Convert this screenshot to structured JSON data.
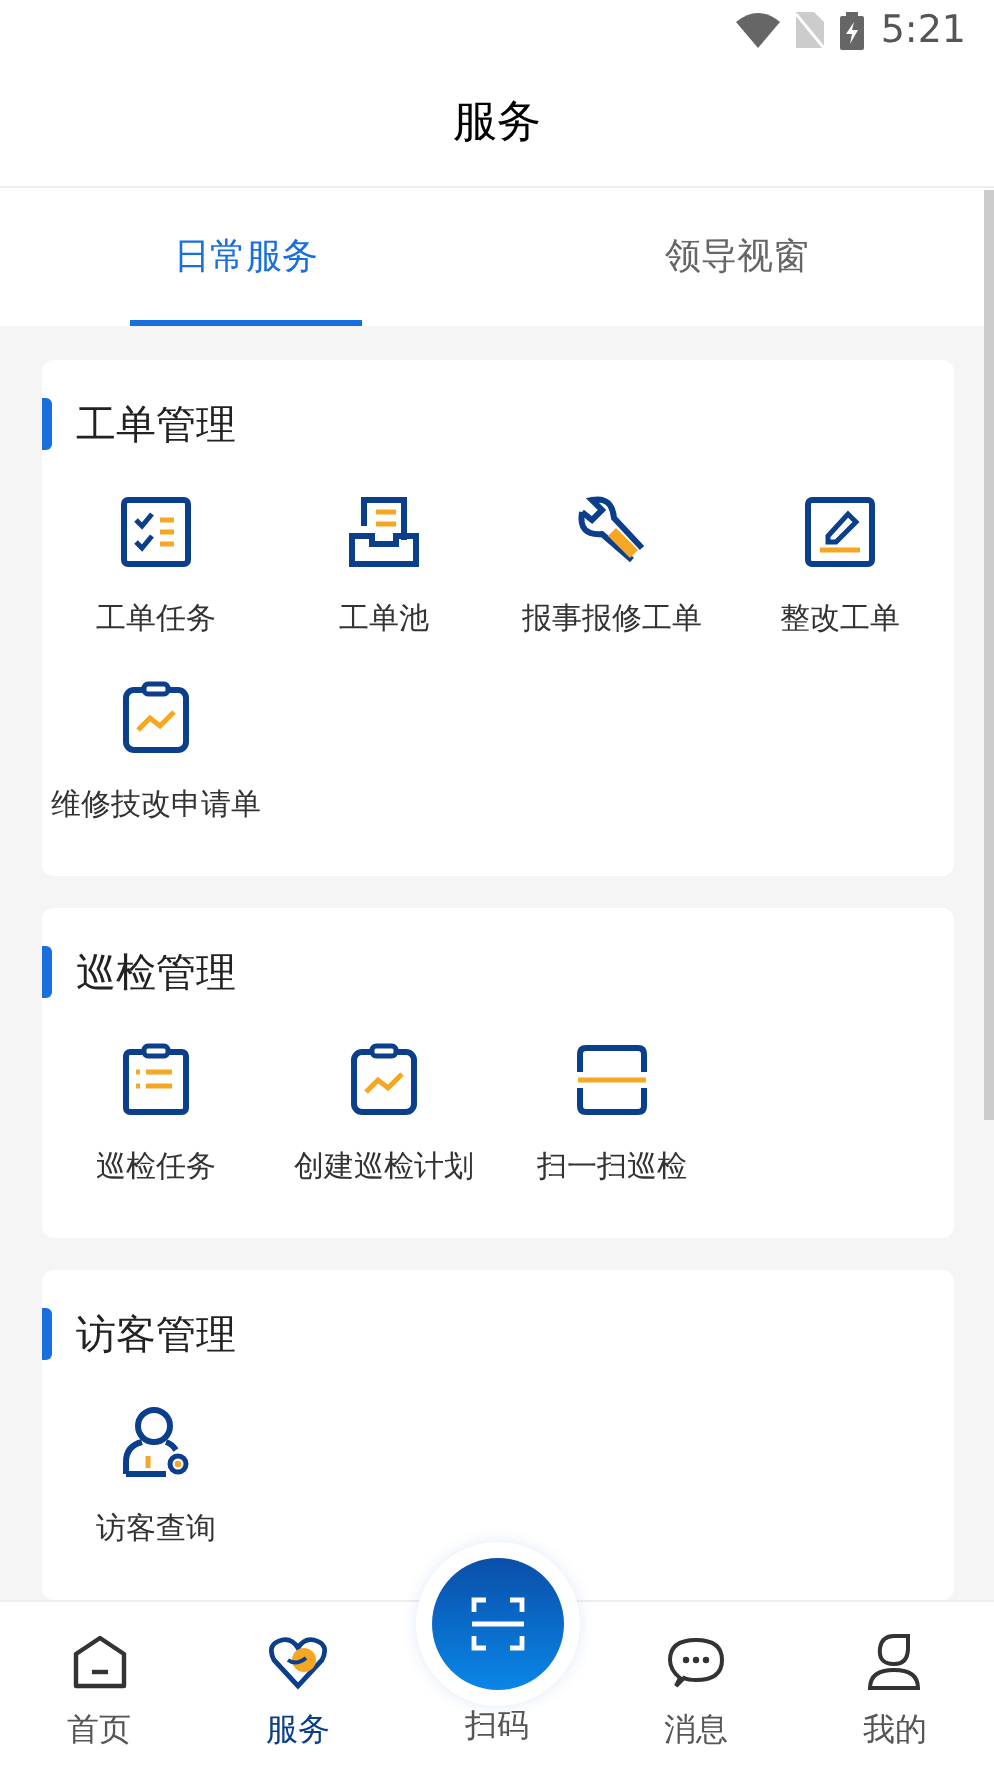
{
  "status_bar": {
    "time": "5:21"
  },
  "header": {
    "title": "服务"
  },
  "tabs": [
    {
      "label": "日常服务",
      "selected": true
    },
    {
      "label": "领导视窗",
      "selected": false
    }
  ],
  "sections": [
    {
      "title": "工单管理",
      "items": [
        {
          "label": "工单任务"
        },
        {
          "label": "工单池"
        },
        {
          "label": "报事报修工单"
        },
        {
          "label": "整改工单"
        },
        {
          "label": "维修技改申请单"
        }
      ]
    },
    {
      "title": "巡检管理",
      "items": [
        {
          "label": "巡检任务"
        },
        {
          "label": "创建巡检计划"
        },
        {
          "label": "扫一扫巡检"
        }
      ]
    },
    {
      "title": "访客管理",
      "items": [
        {
          "label": "访客查询"
        }
      ]
    }
  ],
  "bottom_nav": [
    {
      "label": "首页",
      "selected": false,
      "kind": "home"
    },
    {
      "label": "服务",
      "selected": true,
      "kind": "service"
    },
    {
      "label": "扫码",
      "selected": false,
      "kind": "scan"
    },
    {
      "label": "消息",
      "selected": false,
      "kind": "message"
    },
    {
      "label": "我的",
      "selected": false,
      "kind": "profile"
    }
  ]
}
